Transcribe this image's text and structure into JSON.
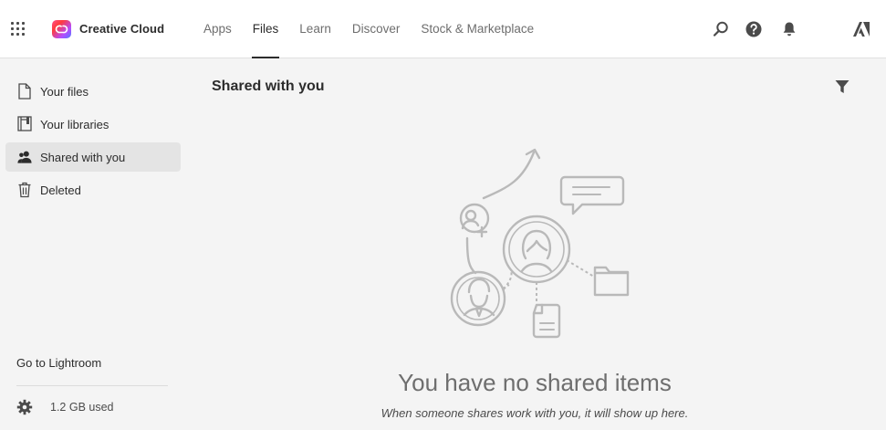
{
  "header": {
    "brand": "Creative Cloud",
    "nav": [
      {
        "label": "Apps",
        "active": false
      },
      {
        "label": "Files",
        "active": true
      },
      {
        "label": "Learn",
        "active": false
      },
      {
        "label": "Discover",
        "active": false
      },
      {
        "label": "Stock & Marketplace",
        "active": false
      }
    ],
    "icons": [
      "apps-grid-icon",
      "search-icon",
      "help-icon",
      "notifications-bell-icon",
      "adobe-logo-icon"
    ]
  },
  "sidebar": {
    "items": [
      {
        "label": "Your files",
        "icon": "file-icon",
        "active": false
      },
      {
        "label": "Your libraries",
        "icon": "library-icon",
        "active": false
      },
      {
        "label": "Shared with you",
        "icon": "people-icon",
        "active": true
      },
      {
        "label": "Deleted",
        "icon": "trash-icon",
        "active": false
      }
    ],
    "lightroom_link": "Go to Lightroom",
    "storage": "1.2 GB used"
  },
  "main": {
    "title": "Shared with you",
    "empty_title": "You have no shared items",
    "empty_subtitle": "When someone shares work with you, it will show up here."
  },
  "colors": {
    "header_bg": "#ffffff",
    "page_bg": "#f4f4f4",
    "active_item_bg": "#e4e4e4",
    "text": "#2c2c2c",
    "illustration_stroke": "#b9b9b9"
  }
}
